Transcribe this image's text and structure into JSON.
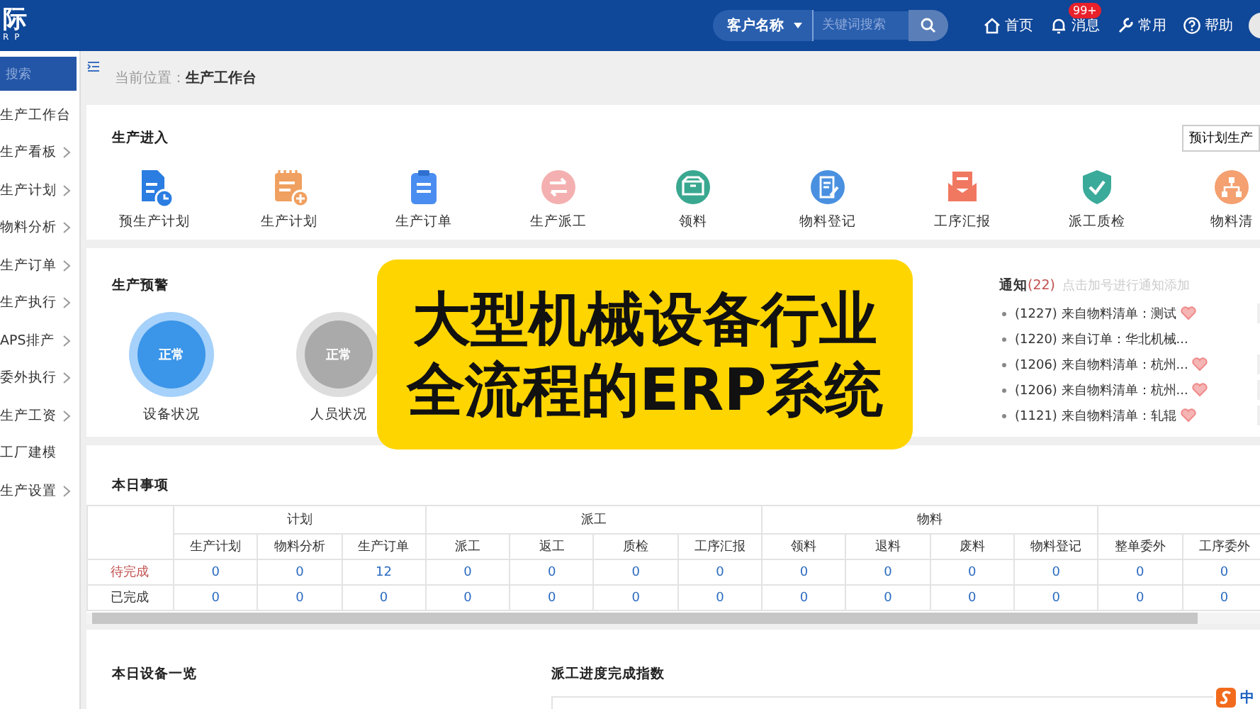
{
  "header": {
    "logo": "际",
    "logo_sub": "R P",
    "search": {
      "scope": "客户名称",
      "placeholder": "关键词搜索"
    },
    "nav": [
      {
        "label": "首页",
        "kind": "home"
      },
      {
        "label": "消息",
        "kind": "bell",
        "badge": "99+"
      },
      {
        "label": "常用",
        "kind": "wrench"
      },
      {
        "label": "帮助",
        "kind": "help"
      }
    ]
  },
  "sidebar": {
    "search_placeholder": "搜索",
    "items": [
      {
        "label": "生产工作台",
        "has_children": false
      },
      {
        "label": "生产看板",
        "has_children": true
      },
      {
        "label": "生产计划",
        "has_children": true
      },
      {
        "label": "物料分析",
        "has_children": true
      },
      {
        "label": "生产订单",
        "has_children": true
      },
      {
        "label": "生产执行",
        "has_children": true
      },
      {
        "label": "APS排产",
        "has_children": true
      },
      {
        "label": "委外执行",
        "has_children": true
      },
      {
        "label": "生产工资",
        "has_children": true
      },
      {
        "label": "工厂建模",
        "has_children": false
      },
      {
        "label": "生产设置",
        "has_children": true
      }
    ]
  },
  "breadcrumb": {
    "prefix": "当前位置：",
    "current": "生产工作台"
  },
  "entry": {
    "title": "生产进入",
    "button": "预计划生产",
    "items": [
      {
        "label": "预生产计划",
        "kind": "schedule"
      },
      {
        "label": "生产计划",
        "kind": "plan"
      },
      {
        "label": "生产订单",
        "kind": "order"
      },
      {
        "label": "生产派工",
        "kind": "dispatch"
      },
      {
        "label": "领料",
        "kind": "pick"
      },
      {
        "label": "物料登记",
        "kind": "register"
      },
      {
        "label": "工序汇报",
        "kind": "report"
      },
      {
        "label": "派工质检",
        "kind": "inspect"
      },
      {
        "label": "物料清",
        "kind": "bom"
      }
    ]
  },
  "warning": {
    "title": "生产预警",
    "gauges": [
      {
        "value": "正常",
        "label": "设备状况",
        "active": true
      },
      {
        "value": "正常",
        "label": "人员状况",
        "active": false
      }
    ]
  },
  "notices": {
    "title": "通知",
    "count": "(22)",
    "hint": "点击加号进行通知添加",
    "items": [
      {
        "text": "(1227) 来自物料清单：测试",
        "flagged": true,
        "action": true
      },
      {
        "text": "(1220) 来自订单：华北机械...",
        "flagged": false,
        "action": false
      },
      {
        "text": "(1206) 来自物料清单：杭州...",
        "flagged": true,
        "action": true
      },
      {
        "text": "(1206) 来自物料清单：杭州...",
        "flagged": true,
        "action": true
      },
      {
        "text": "(1121) 来自物料清单：轧辊",
        "flagged": true,
        "action": true
      }
    ]
  },
  "today": {
    "title": "本日事项",
    "groups": [
      {
        "label": "计划",
        "columns": [
          "生产计划",
          "物料分析",
          "生产订单"
        ]
      },
      {
        "label": "派工",
        "columns": [
          "派工",
          "返工",
          "质检",
          "工序汇报"
        ]
      },
      {
        "label": "物料",
        "columns": [
          "领料",
          "退料",
          "废料",
          "物料登记"
        ]
      },
      {
        "columns": [
          "整单委外",
          "工序委外"
        ]
      }
    ],
    "rows": [
      {
        "label": "待完成",
        "pending": true,
        "values": [
          "0",
          "0",
          "12",
          "0",
          "0",
          "0",
          "0",
          "0",
          "0",
          "0",
          "0",
          "0",
          "0"
        ]
      },
      {
        "label": "已完成",
        "pending": false,
        "values": [
          "0",
          "0",
          "0",
          "0",
          "0",
          "0",
          "0",
          "0",
          "0",
          "0",
          "0",
          "0",
          "0"
        ]
      }
    ]
  },
  "bottom": {
    "left_title": "本日设备一览",
    "right_title": "派工进度完成指数"
  },
  "overlay": {
    "lines": [
      "大型机械设备行业",
      "全流程的ERP系统"
    ]
  },
  "ime": {
    "label": "中"
  }
}
